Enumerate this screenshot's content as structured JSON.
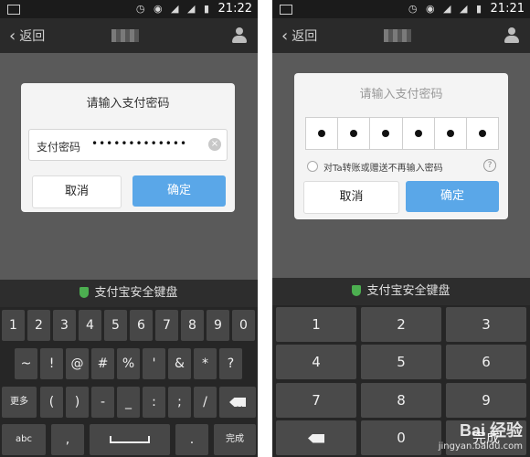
{
  "left": {
    "status": {
      "time": "21:22"
    },
    "nav": {
      "back": "返回"
    },
    "dialog": {
      "title": "请输入支付密码",
      "pwd_label": "支付密码",
      "pwd_value": "•••••••••••••",
      "cancel": "取消",
      "confirm": "确定"
    },
    "keyboard": {
      "header": "支付宝安全键盘",
      "rows": [
        [
          "1",
          "2",
          "3",
          "4",
          "5",
          "6",
          "7",
          "8",
          "9",
          "0"
        ],
        [
          "~",
          "!",
          "@",
          "#",
          "%",
          "'",
          "&",
          "*",
          "?"
        ],
        [
          "更多",
          "(",
          ")",
          "-",
          "_",
          ":",
          ";",
          "/",
          "⌫"
        ],
        [
          "abc",
          ",",
          "␣",
          ".",
          "完成"
        ]
      ]
    }
  },
  "right": {
    "status": {
      "time": "21:21"
    },
    "nav": {
      "back": "返回"
    },
    "dialog": {
      "title": "请输入支付密码",
      "digits_entered": 6,
      "skip_text": "对Ta转账或赠送不再输入密码",
      "help": "?",
      "cancel": "取消",
      "confirm": "确定"
    },
    "keyboard": {
      "header": "支付宝安全键盘",
      "rows": [
        [
          "1",
          "2",
          "3"
        ],
        [
          "4",
          "5",
          "6"
        ],
        [
          "7",
          "8",
          "9"
        ],
        [
          "⌫",
          "0",
          "完成"
        ]
      ]
    }
  },
  "watermark": {
    "main": "Bai 经验",
    "sub": "jingyan.baidu.com"
  },
  "colors": {
    "confirm_blue": "#5aa7e8",
    "shield_green": "#4caf50",
    "keyboard_bg": "#262626",
    "key_bg": "#474747"
  }
}
